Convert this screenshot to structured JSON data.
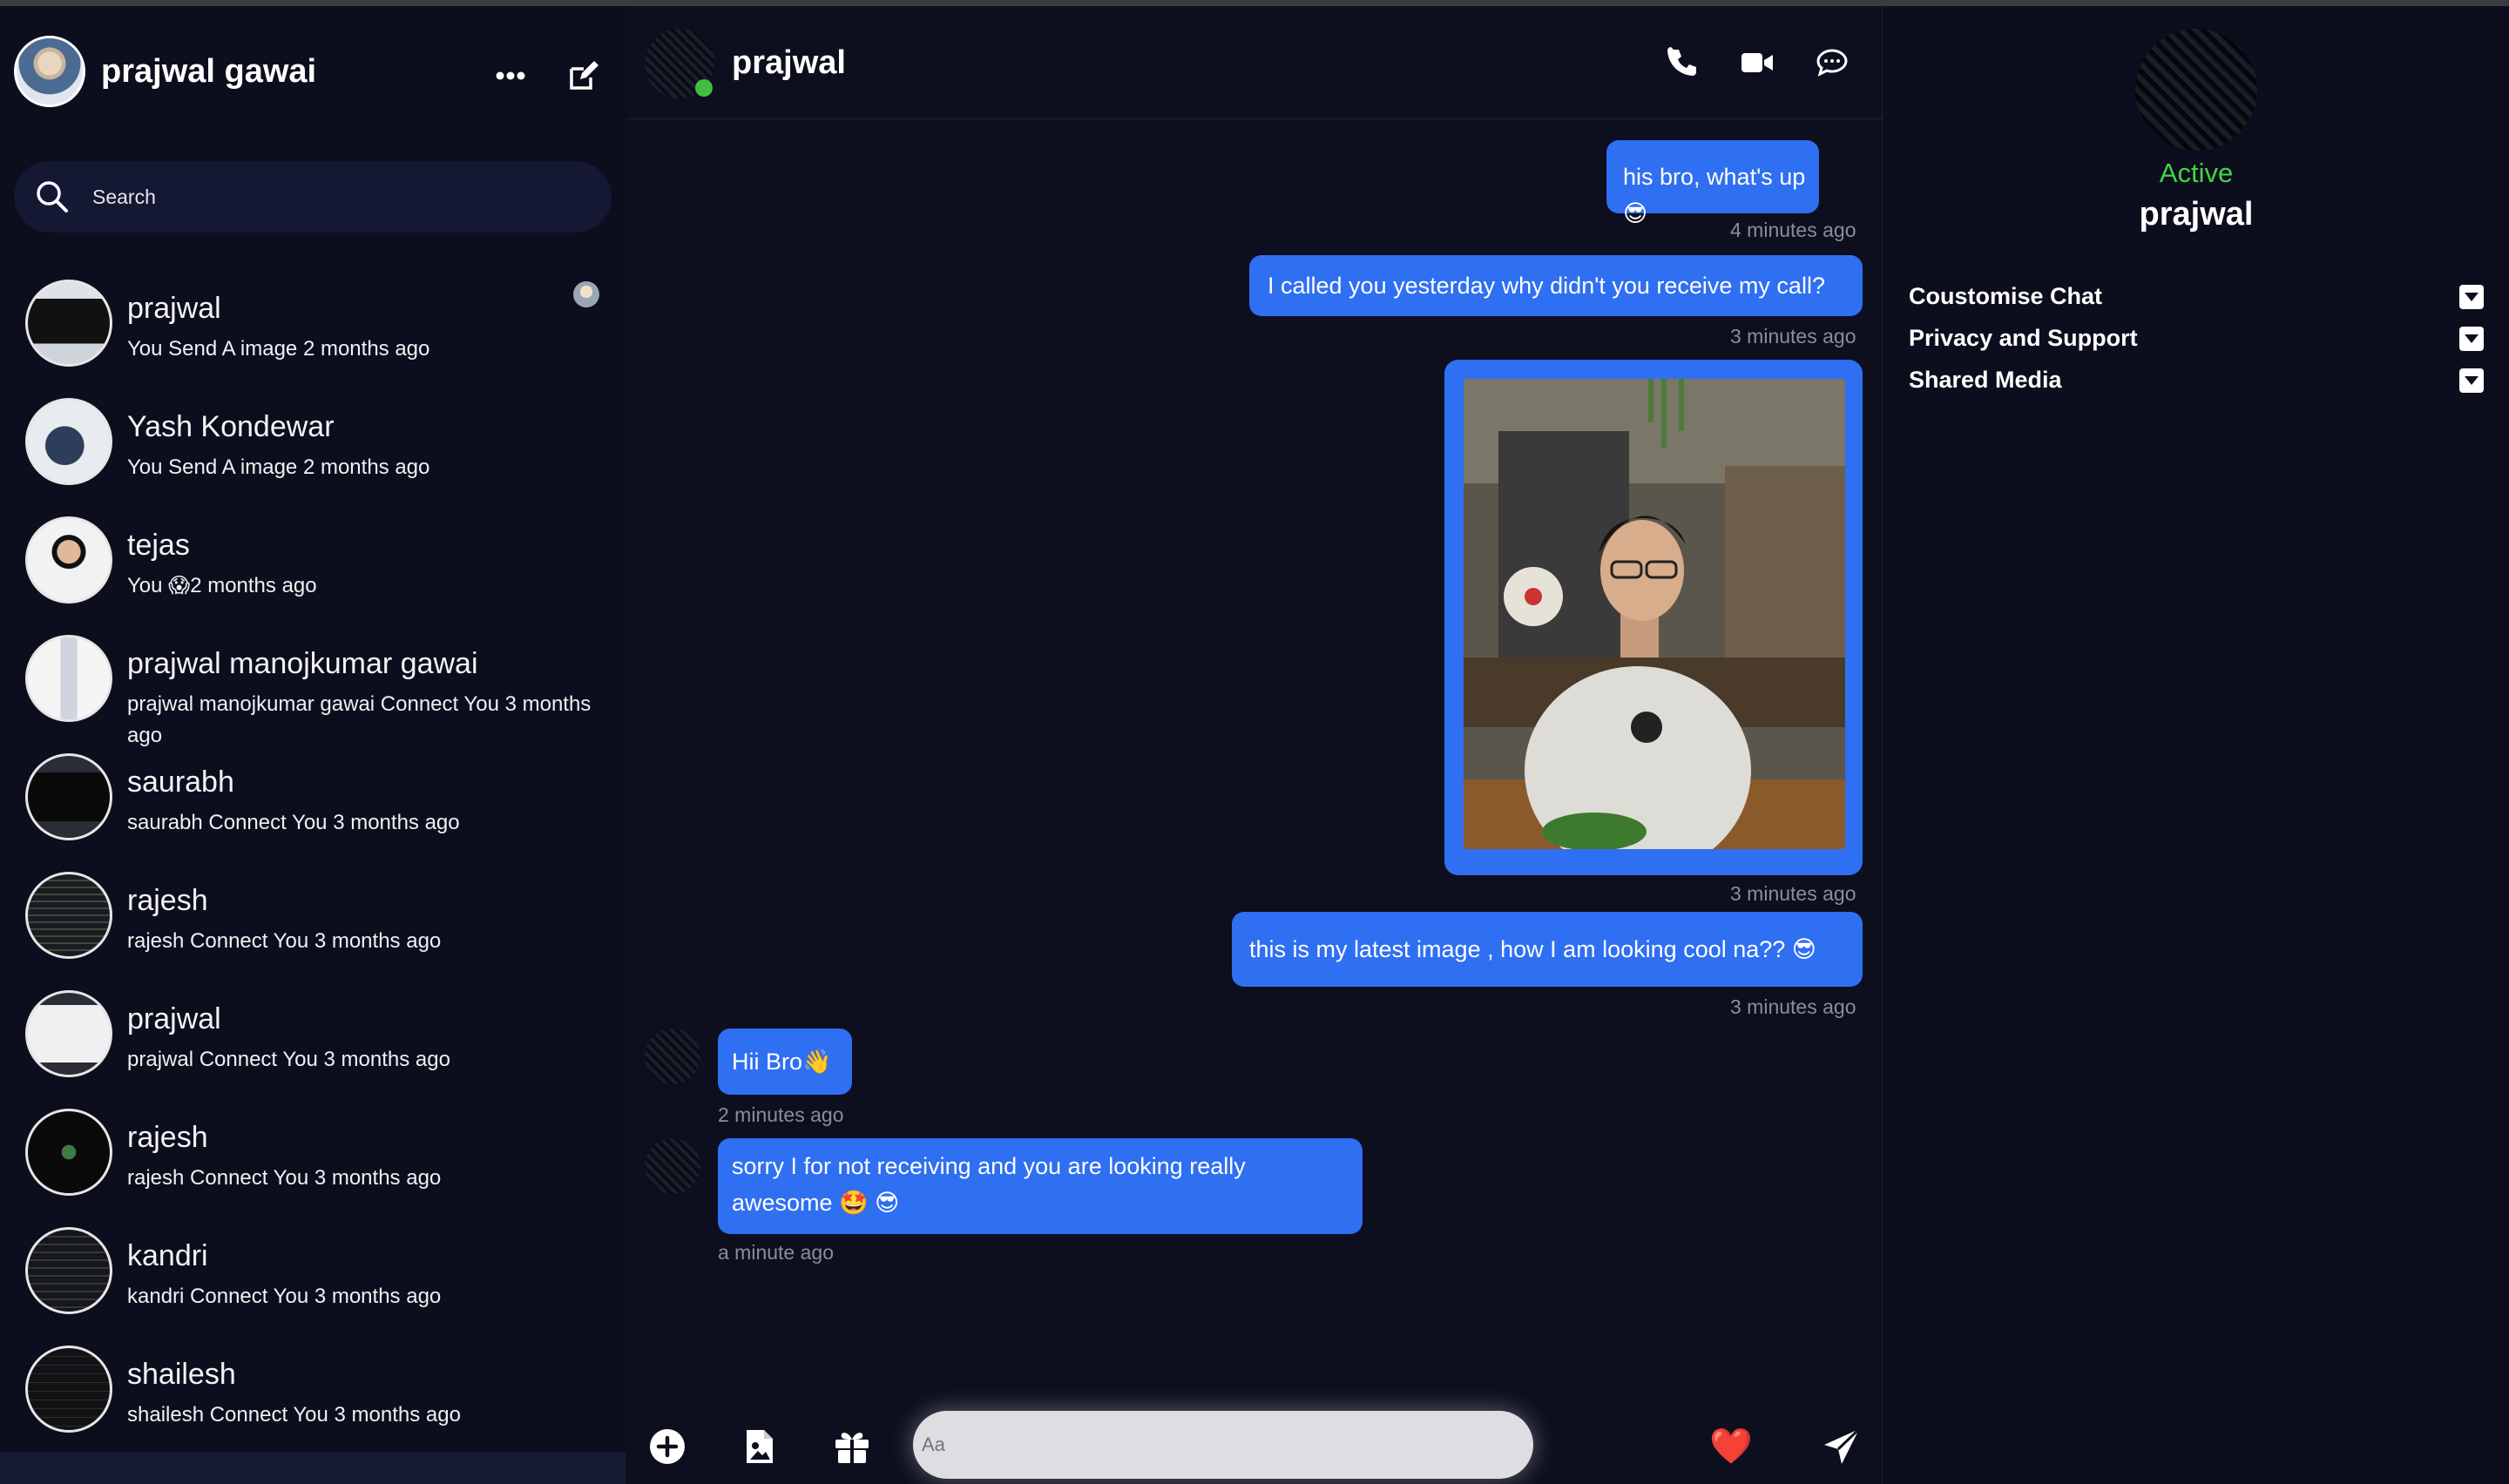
{
  "user": {
    "name": "prajwal gawai"
  },
  "search": {
    "label": "Search"
  },
  "contacts": [
    {
      "name": "prajwal",
      "sub": "You Send A image 2 months ago"
    },
    {
      "name": "Yash Kondewar",
      "sub": "You Send A image 2 months ago"
    },
    {
      "name": "tejas",
      "sub": "You 😱2 months ago"
    },
    {
      "name": "prajwal manojkumar gawai",
      "sub": "prajwal manojkumar gawai Connect You 3 months ago"
    },
    {
      "name": "saurabh",
      "sub": "saurabh Connect You 3 months ago"
    },
    {
      "name": "rajesh",
      "sub": "rajesh Connect You 3 months ago"
    },
    {
      "name": "prajwal",
      "sub": "prajwal Connect You 3 months ago"
    },
    {
      "name": "rajesh",
      "sub": "rajesh Connect You 3 months ago"
    },
    {
      "name": "kandri",
      "sub": "kandri Connect You 3 months ago"
    },
    {
      "name": "shailesh",
      "sub": "shailesh Connect You 3 months ago"
    }
  ],
  "chat": {
    "name": "prajwal",
    "messages": [
      {
        "text": "his bro, what's up😎",
        "time": "4 minutes ago"
      },
      {
        "text": "I called you yesterday why didn't you receive my call?",
        "time": "3 minutes ago"
      },
      {
        "time": "3 minutes ago"
      },
      {
        "text": "this is my latest image , how I am looking cool na?? 😎",
        "time": "3 minutes ago"
      },
      {
        "text": "Hii Bro👋",
        "time": "2 minutes ago"
      },
      {
        "text": "sorry I for not receiving and you are looking really awesome 🤩 😎",
        "time": "a minute ago"
      }
    ]
  },
  "composer": {
    "placeholder": "Aa",
    "quick_reaction": "❤️"
  },
  "profile": {
    "status": "Active",
    "name": "prajwal",
    "sections": [
      "Coustomise Chat",
      "Privacy and Support",
      "Shared Media"
    ]
  },
  "colors": {
    "background": "#0d0f1f",
    "bubble": "#2f6ff2",
    "active": "#44d24a"
  }
}
